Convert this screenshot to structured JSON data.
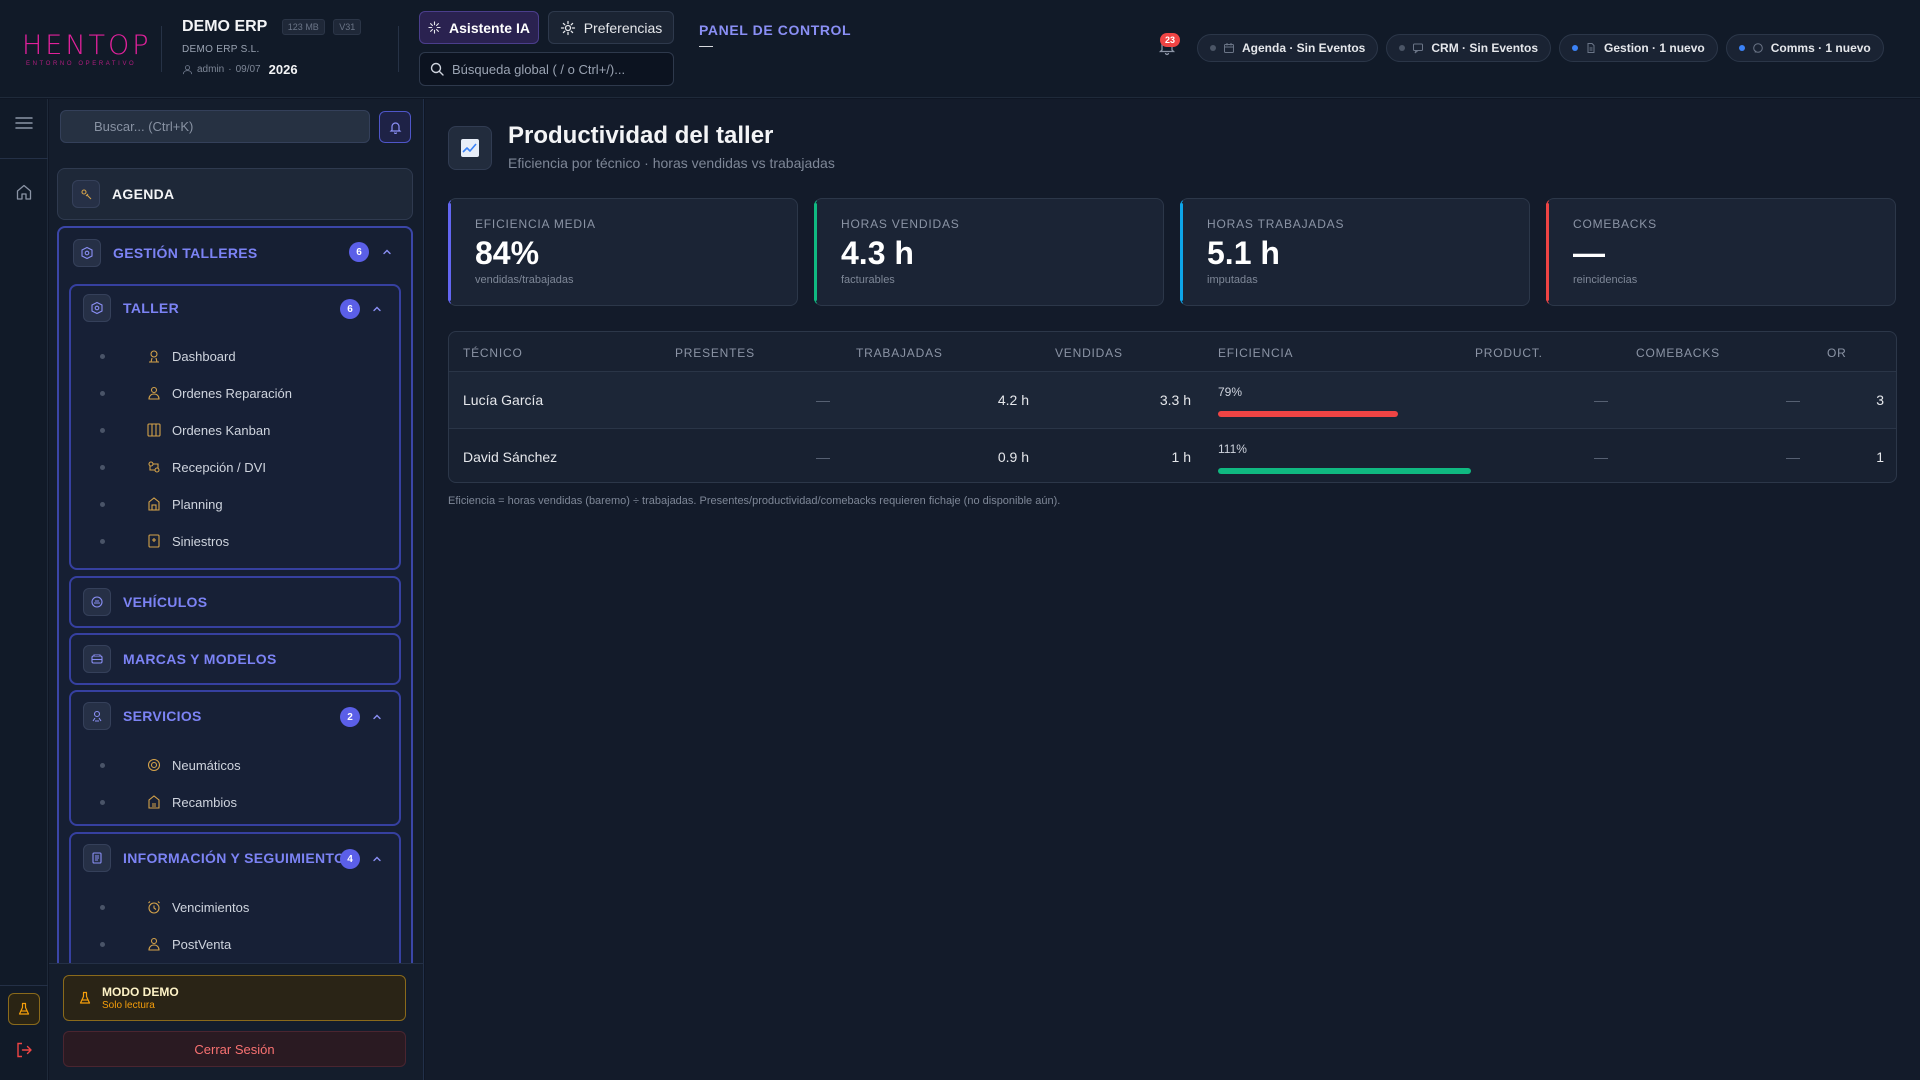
{
  "app": {
    "logo_text": "HENTOP",
    "logo_sub": "ENTORNO OPERATIVO",
    "company_name": "DEMO ERP",
    "mem_chip": "123 MB",
    "version_chip": "V31",
    "company_legal": "DEMO ERP S.L.",
    "user": "admin",
    "date": "09/07",
    "year": "2026"
  },
  "header": {
    "ai_button": "Asistente IA",
    "prefs_button": "Preferencias",
    "search_placeholder": "Búsqueda global ( / o Ctrl+/)...",
    "panel_title": "PANEL DE CONTROL",
    "panel_sub": "—",
    "notif_count": "23",
    "pills": [
      {
        "label": "Agenda · Sin Eventos",
        "dot": "#4b5566"
      },
      {
        "label": "CRM · Sin Eventos",
        "dot": "#4b5566"
      },
      {
        "label": "Gestion · 1 nuevo",
        "dot": "#3b82f6"
      },
      {
        "label": "Comms · 1 nuevo",
        "dot": "#3b82f6"
      }
    ]
  },
  "sidebar": {
    "search_placeholder": "Buscar... (Ctrl+K)",
    "agenda": "AGENDA",
    "gestion": {
      "label": "GESTIÓN TALLERES",
      "count": "6"
    },
    "taller": {
      "label": "TALLER",
      "count": "6",
      "items": [
        "Dashboard",
        "Ordenes Reparación",
        "Ordenes Kanban",
        "Recepción / DVI",
        "Planning",
        "Siniestros"
      ]
    },
    "vehiculos": "VEHÍCULOS",
    "marcas": "MARCAS Y MODELOS",
    "servicios": {
      "label": "SERVICIOS",
      "count": "2",
      "items": [
        "Neumáticos",
        "Recambios"
      ]
    },
    "info": {
      "label": "INFORMACIÓN Y SEGUIMIENTO",
      "count": "4",
      "items": [
        "Vencimientos",
        "PostVenta"
      ]
    },
    "demo_title": "MODO DEMO",
    "demo_sub": "Solo lectura",
    "logout": "Cerrar Sesión"
  },
  "page": {
    "title": "Productividad del taller",
    "subtitle": "Eficiencia por técnico · horas vendidas vs trabajadas",
    "kpis": [
      {
        "label": "EFICIENCIA MEDIA",
        "value": "84%",
        "caption": "vendidas/trabajadas",
        "color": "#6366f1"
      },
      {
        "label": "HORAS VENDIDAS",
        "value": "4.3 h",
        "caption": "facturables",
        "color": "#10b981"
      },
      {
        "label": "HORAS TRABAJADAS",
        "value": "5.1 h",
        "caption": "imputadas",
        "color": "#0ea5e9"
      },
      {
        "label": "COMEBACKS",
        "value": "—",
        "caption": "reincidencias",
        "color": "#ef4444"
      }
    ],
    "table": {
      "headers": [
        "TÉCNICO",
        "PRESENTES",
        "TRABAJADAS",
        "VENDIDAS",
        "EFICIENCIA",
        "PRODUCT.",
        "COMEBACKS",
        "OR"
      ],
      "rows": [
        {
          "tecnico": "Lucía García",
          "presentes": "—",
          "trabajadas": "4.2 h",
          "vendidas": "3.3 h",
          "eficiencia": "79%",
          "eff_value": 79,
          "eff_color": "#ef4444",
          "product": "—",
          "comebacks": "—",
          "or": "3"
        },
        {
          "tecnico": "David Sánchez",
          "presentes": "—",
          "trabajadas": "0.9 h",
          "vendidas": "1 h",
          "eficiencia": "111%",
          "eff_value": 111,
          "eff_color": "#10b981",
          "product": "—",
          "comebacks": "—",
          "or": "1"
        }
      ]
    },
    "footnote": "Eficiencia = horas vendidas (baremo) ÷ trabajadas. Presentes/productividad/comebacks requieren fichaje (no disponible aún)."
  }
}
